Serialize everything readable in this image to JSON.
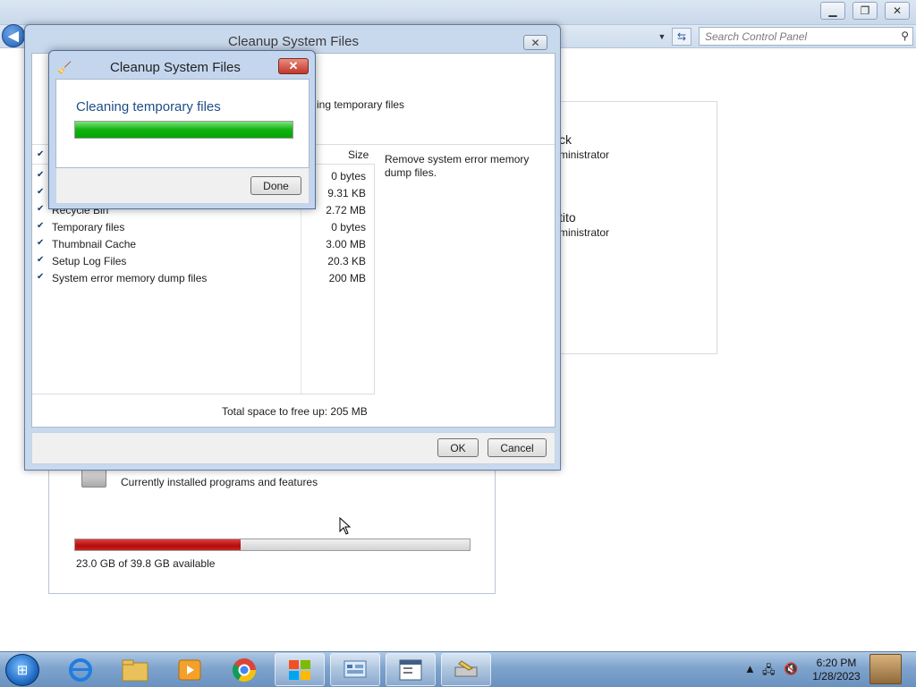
{
  "window": {
    "title": "Cleanup System Files",
    "search": {
      "placeholder": "Search Control Panel"
    }
  },
  "users": [
    {
      "name": "ck",
      "role": "ministrator"
    },
    {
      "name": "tito",
      "role": "ministrator"
    }
  ],
  "programs": {
    "description": "Currently installed programs and features",
    "disk_label": "23.0 GB of 39.8 GB available",
    "disk_used_fraction": 0.42
  },
  "cleanup_dialog": {
    "title": "Cleanup System Files",
    "header_text": "ing temporary files",
    "size_column": "Size",
    "items": [
      {
        "name": "",
        "size": "0 bytes",
        "checked": true
      },
      {
        "name": "",
        "size": "9.31 KB",
        "checked": true
      },
      {
        "name": "Recycle Bin",
        "size": "2.72 MB",
        "checked": true
      },
      {
        "name": "Temporary files",
        "size": "0 bytes",
        "checked": true
      },
      {
        "name": "Thumbnail Cache",
        "size": "3.00 MB",
        "checked": true
      },
      {
        "name": "Setup Log Files",
        "size": "20.3 KB",
        "checked": true
      },
      {
        "name": "System error memory dump files",
        "size": "200 MB",
        "checked": true
      }
    ],
    "total": "Total space to free up: 205 MB",
    "description": "Remove system error memory dump files.",
    "ok_label": "OK",
    "cancel_label": "Cancel"
  },
  "progress_dialog": {
    "title": "Cleanup System Files",
    "status": "Cleaning temporary files",
    "progress_fraction": 1.0,
    "done_label": "Done",
    "close_glyph": "✕"
  },
  "taskbar": {
    "time": "6:20 PM",
    "date": "1/28/2023",
    "icons": [
      "start-orb",
      "internet-explorer-icon",
      "file-explorer-icon",
      "media-player-icon",
      "chrome-icon",
      "windows-logo-icon",
      "control-panel-icon",
      "document-window-icon",
      "disk-cleanup-icon"
    ]
  },
  "colors": {
    "disk_bar": "#c81414",
    "progress_bar": "#10b310",
    "accent_text": "#1f4d86"
  }
}
